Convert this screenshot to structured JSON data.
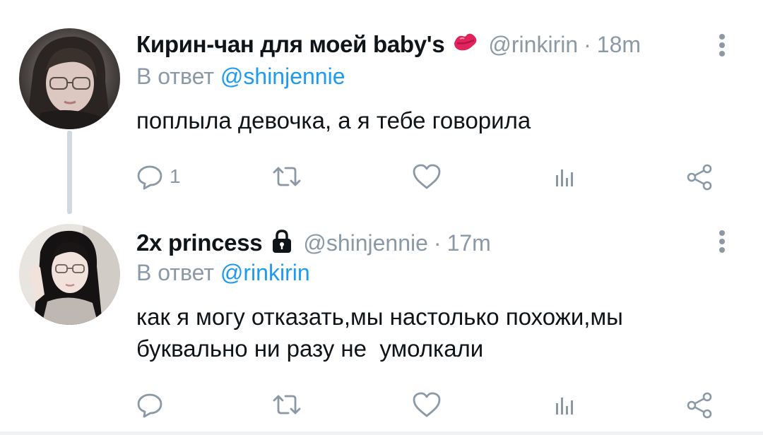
{
  "tweets": [
    {
      "author": {
        "display_name": "Кирин-чан для моей baby's",
        "badge_icon": "kiss-lips-emoji",
        "handle": "@rinkirin",
        "avatar_desc": "avatar-photo"
      },
      "separator": "·",
      "time": "18m",
      "reply_prefix": "В ответ",
      "reply_to": "@shinjennie",
      "text": "поплыла девочка, а я тебе говорила",
      "actions": {
        "reply_count": "1",
        "retweet_count": "",
        "like_count": "",
        "views_count": ""
      }
    },
    {
      "author": {
        "display_name": "2x princess",
        "badge_icon": "lock-icon",
        "handle": "@shinjennie",
        "avatar_desc": "avatar-photo"
      },
      "separator": "·",
      "time": "17m",
      "reply_prefix": "В ответ",
      "reply_to": "@rinkirin",
      "text": "как я могу отказать,мы настолько похожи,мы\nбуквально ни разу не  умолкали",
      "actions": {
        "reply_count": "",
        "retweet_count": "",
        "like_count": "",
        "views_count": ""
      }
    }
  ],
  "colors": {
    "secondary_text": "#8b98a5",
    "link": "#1d9bf0",
    "primary_text": "#0f1419",
    "thread_line": "#cfd9de",
    "kiss": "#e0245e"
  }
}
